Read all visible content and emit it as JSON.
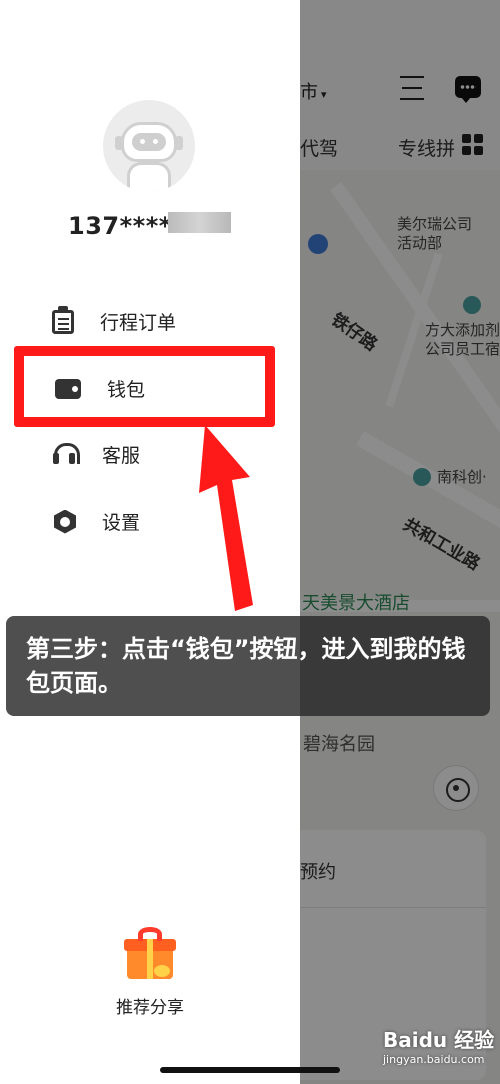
{
  "map": {
    "city_partial": "市",
    "tab_partial": "代驾",
    "tab_zhuanxian": "专线拼",
    "poi_meierrui": "美尔瑞公司活动部",
    "road_tiezai": "铁仔路",
    "poi_fangda": "方大添加剂公司员工宿",
    "poi_nanke": "南科创·",
    "road_gonghe": "共和工业路",
    "poi_hotel": "天美景大酒店",
    "poi_bihai": "碧海名园",
    "yuyue_partial": "预约"
  },
  "drawer": {
    "phone": "137****",
    "menu": [
      {
        "label": "行程订单",
        "icon": "trip-list-icon"
      },
      {
        "label": "钱包",
        "icon": "wallet-icon"
      },
      {
        "label": "客服",
        "icon": "headset-icon"
      },
      {
        "label": "设置",
        "icon": "settings-icon"
      }
    ],
    "share_label": "推荐分享"
  },
  "caption": "第三步：点击“钱包”按钮，进入到我的钱包页面。",
  "watermark": {
    "main": "Baidu 经验",
    "sub": "jingyan.baidu.com"
  },
  "colors": {
    "highlight": "#ff1a1a",
    "caption_bg": "#282828"
  }
}
